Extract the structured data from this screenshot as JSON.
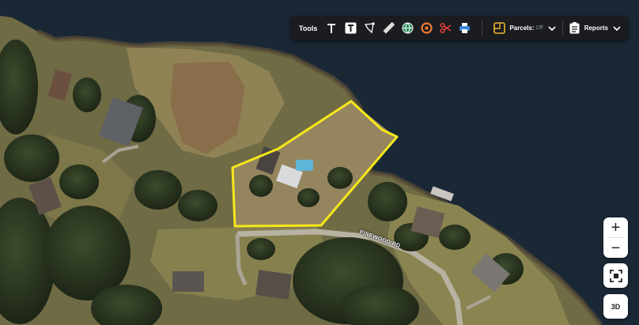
{
  "toolbar": {
    "tools_label": "Tools",
    "parcels_label": "Parcels:",
    "parcels_state": "Off",
    "reports_label": "Reports",
    "icons": [
      "text-icon",
      "text-box-icon",
      "polygon-draw-icon",
      "ruler-icon",
      "globe-icon",
      "buffer-ring-icon",
      "scissors-icon",
      "print-icon",
      "parcels-icon",
      "reports-icon"
    ]
  },
  "map": {
    "road_label": "PINEWOOD RD",
    "highlight_color": "#f5e81a",
    "water_color": "#1a2836"
  },
  "controls": {
    "zoom_in": "+",
    "zoom_out": "−",
    "three_d": "3D"
  }
}
